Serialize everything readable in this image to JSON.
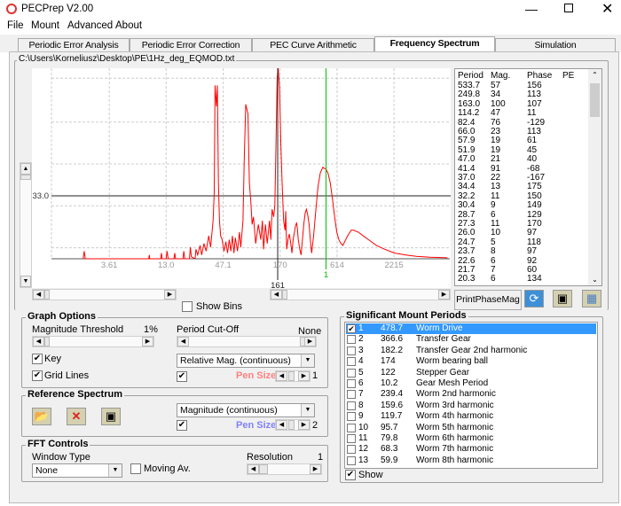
{
  "window": {
    "title": "PECPrep V2.00",
    "controls": [
      "minimize",
      "maximize",
      "close"
    ]
  },
  "menu": [
    "File",
    "Mount",
    "Advanced",
    "About"
  ],
  "tabs": [
    {
      "label": "Periodic Error Analysis"
    },
    {
      "label": "Periodic Error Correction"
    },
    {
      "label": "PEC Curve Arithmetic"
    },
    {
      "label": "Frequency Spectrum",
      "active": true
    },
    {
      "label": "Simulation"
    }
  ],
  "file_path": "C:\\Users\\Korneliusz\\Desktop\\PE\\1Hz_deg_EQMOD.txt",
  "chart_data": {
    "type": "line",
    "x_scale": "log",
    "xlim": [
      0.98,
      7800
    ],
    "ylim": [
      0,
      100
    ],
    "grid": true,
    "x_ticks": [
      "3.61",
      "13.0",
      "47.1",
      "170",
      "614",
      "2215"
    ],
    "x_tick_values": [
      3.61,
      13.0,
      47.1,
      170,
      614,
      2215
    ],
    "hline": {
      "value": 33.0,
      "label": "33.0"
    },
    "cursor": {
      "value": 161,
      "label": "161"
    },
    "marker": {
      "value": 478.7,
      "label": "1",
      "color": "#00c000"
    },
    "series": [
      {
        "color": "#ff0000",
        "points": [
          [
            2.0,
            0
          ],
          [
            2.05,
            4
          ],
          [
            2.1,
            0
          ],
          [
            8.8,
            0
          ],
          [
            8.9,
            2
          ],
          [
            9.0,
            0
          ],
          [
            11.5,
            0
          ],
          [
            11.7,
            3
          ],
          [
            11.9,
            0
          ],
          [
            13.0,
            0
          ],
          [
            13.3,
            4
          ],
          [
            13.6,
            0
          ],
          [
            15.5,
            0
          ],
          [
            15.8,
            3
          ],
          [
            16.1,
            0
          ],
          [
            19,
            0
          ],
          [
            19.4,
            4
          ],
          [
            19.8,
            0
          ],
          [
            22,
            0
          ],
          [
            22.5,
            6
          ],
          [
            23,
            1
          ],
          [
            25,
            0
          ],
          [
            25.5,
            5
          ],
          [
            26.5,
            2
          ],
          [
            28,
            7
          ],
          [
            29,
            2
          ],
          [
            30.5,
            8
          ],
          [
            32,
            4
          ],
          [
            34,
            12
          ],
          [
            35.5,
            6
          ],
          [
            37.5,
            20
          ],
          [
            38.5,
            35
          ],
          [
            39.2,
            91
          ],
          [
            40.5,
            80
          ],
          [
            41.3,
            91
          ],
          [
            42.3,
            40
          ],
          [
            43.3,
            20
          ],
          [
            44.5,
            12
          ],
          [
            46,
            10
          ],
          [
            48,
            4
          ],
          [
            50,
            9
          ],
          [
            52,
            3
          ],
          [
            54,
            10
          ],
          [
            56,
            4
          ],
          [
            58,
            12
          ],
          [
            60,
            3
          ],
          [
            62,
            11
          ],
          [
            65,
            4
          ],
          [
            68,
            14
          ],
          [
            70,
            6
          ],
          [
            73.6,
            20
          ],
          [
            75.5,
            50
          ],
          [
            78.3,
            81
          ],
          [
            82.4,
            76
          ],
          [
            85,
            40
          ],
          [
            87.8,
            30
          ],
          [
            90.5,
            18
          ],
          [
            93.2,
            22
          ],
          [
            98,
            8
          ],
          [
            104,
            18
          ],
          [
            110,
            10
          ],
          [
            114,
            20
          ],
          [
            117,
            5
          ],
          [
            122,
            18
          ],
          [
            127,
            8
          ],
          [
            134,
            20
          ],
          [
            138,
            10
          ],
          [
            142,
            26
          ],
          [
            147,
            22
          ],
          [
            151,
            28
          ],
          [
            155,
            60
          ],
          [
            159,
            95
          ],
          [
            163,
            100
          ],
          [
            168,
            90
          ],
          [
            173,
            60
          ],
          [
            178,
            40
          ],
          [
            184,
            20
          ],
          [
            190,
            15
          ],
          [
            193,
            25
          ],
          [
            197,
            5
          ],
          [
            203,
            10
          ],
          [
            209,
            13
          ],
          [
            215,
            9
          ],
          [
            222,
            3
          ],
          [
            228,
            10
          ],
          [
            235,
            14
          ],
          [
            240,
            17
          ],
          [
            247,
            19
          ],
          [
            252,
            15
          ],
          [
            256,
            10
          ],
          [
            265,
            5
          ],
          [
            273,
            2
          ],
          [
            281,
            10
          ],
          [
            290,
            18
          ],
          [
            299,
            24
          ],
          [
            308,
            26
          ],
          [
            317,
            23
          ],
          [
            327,
            18
          ],
          [
            336,
            10
          ],
          [
            346,
            3
          ],
          [
            362,
            12
          ],
          [
            380,
            25
          ],
          [
            400,
            38
          ],
          [
            420,
            45
          ],
          [
            445,
            48
          ],
          [
            479,
            47
          ],
          [
            500,
            45
          ],
          [
            526,
            40
          ],
          [
            552,
            32
          ],
          [
            581,
            22
          ],
          [
            610,
            14
          ],
          [
            640,
            10
          ],
          [
            670,
            8
          ],
          [
            702,
            7
          ],
          [
            745,
            10
          ],
          [
            798,
            13
          ],
          [
            845,
            15
          ],
          [
            888,
            15
          ],
          [
            990,
            14
          ],
          [
            1110,
            12
          ],
          [
            1290,
            9.5
          ],
          [
            1490,
            7
          ],
          [
            1800,
            5
          ],
          [
            2250,
            3
          ],
          [
            2900,
            2
          ],
          [
            3660,
            1.3
          ],
          [
            5000,
            0.8
          ],
          [
            7400,
            0.5
          ]
        ]
      }
    ]
  },
  "period_table": {
    "headers": [
      "Period",
      "Mag.",
      "Phase",
      "PE"
    ],
    "rows": [
      [
        "533.7",
        "57",
        "156"
      ],
      [
        "249.8",
        "34",
        "113"
      ],
      [
        "163.0",
        "100",
        "107"
      ],
      [
        "114.2",
        "47",
        "11"
      ],
      [
        "82.4",
        "76",
        "-129"
      ],
      [
        "66.0",
        "23",
        "113"
      ],
      [
        "57.9",
        "19",
        "61"
      ],
      [
        "51.9",
        "19",
        "45"
      ],
      [
        "47.0",
        "21",
        "40"
      ],
      [
        "41.4",
        "91",
        "-68"
      ],
      [
        "37.0",
        "22",
        "-167"
      ],
      [
        "34.4",
        "13",
        "175"
      ],
      [
        "32.2",
        "11",
        "150"
      ],
      [
        "30.4",
        "9",
        "149"
      ],
      [
        "28.7",
        "6",
        "129"
      ],
      [
        "27.3",
        "11",
        "170"
      ],
      [
        "26.0",
        "10",
        "97"
      ],
      [
        "24.7",
        "5",
        "118"
      ],
      [
        "23.7",
        "8",
        "97"
      ],
      [
        "22.6",
        "6",
        "92"
      ],
      [
        "21.7",
        "7",
        "60"
      ],
      [
        "20.3",
        "6",
        "134"
      ]
    ]
  },
  "print_button": "PrintPhaseMag",
  "show_bins": {
    "label": "Show Bins",
    "checked": false
  },
  "graph_options": {
    "title": "Graph Options",
    "magnitude_threshold_label": "Magnitude Threshold",
    "magnitude_threshold_value": "1%",
    "period_cutoff_label": "Period Cut-Off",
    "period_cutoff_value": "None",
    "key_label": "Key",
    "key_checked": true,
    "grid_label": "Grid Lines",
    "grid_checked": true,
    "display_mode": "Relative Mag. (continuous)",
    "pen_label": "Pen Size",
    "pen_value": "1",
    "pen_color": "#ff8080"
  },
  "reference_spectrum": {
    "title": "Reference Spectrum",
    "display_mode": "Magnitude (continuous)",
    "pen_label": "Pen Size",
    "pen_value": "2",
    "pen_color": "#8080ff"
  },
  "fft_controls": {
    "title": "FFT Controls",
    "window_type_label": "Window Type",
    "window_type": "None",
    "moving_av_label": "Moving Av.",
    "moving_av_checked": false,
    "resolution_label": "Resolution",
    "resolution_value": "1"
  },
  "significant_periods": {
    "title": "Significant Mount Periods",
    "rows": [
      [
        "1",
        "478.7",
        "Worm Drive"
      ],
      [
        "2",
        "366.6",
        "Transfer Gear"
      ],
      [
        "3",
        "182.2",
        "Transfer Gear 2nd harmonic"
      ],
      [
        "4",
        "174",
        "Worm bearing ball"
      ],
      [
        "5",
        "122",
        "Stepper Gear"
      ],
      [
        "6",
        "10.2",
        "Gear Mesh Period"
      ],
      [
        "7",
        "239.4",
        "Worm 2nd harmonic"
      ],
      [
        "8",
        "159.6",
        "Worm 3rd harmonic"
      ],
      [
        "9",
        "119.7",
        "Worm 4th harmonic"
      ],
      [
        "10",
        "95.7",
        "Worm 5th harmonic"
      ],
      [
        "11",
        "79.8",
        "Worm 6th harmonic"
      ],
      [
        "12",
        "68.3",
        "Worm 7th harmonic"
      ],
      [
        "13",
        "59.9",
        "Worm 8th harmonic"
      ]
    ],
    "checked_index": 0,
    "show_label": "Show",
    "show_checked": true
  },
  "colors": {
    "accent": "#3399ff",
    "series": "#ff0000",
    "marker": "#00c000"
  }
}
